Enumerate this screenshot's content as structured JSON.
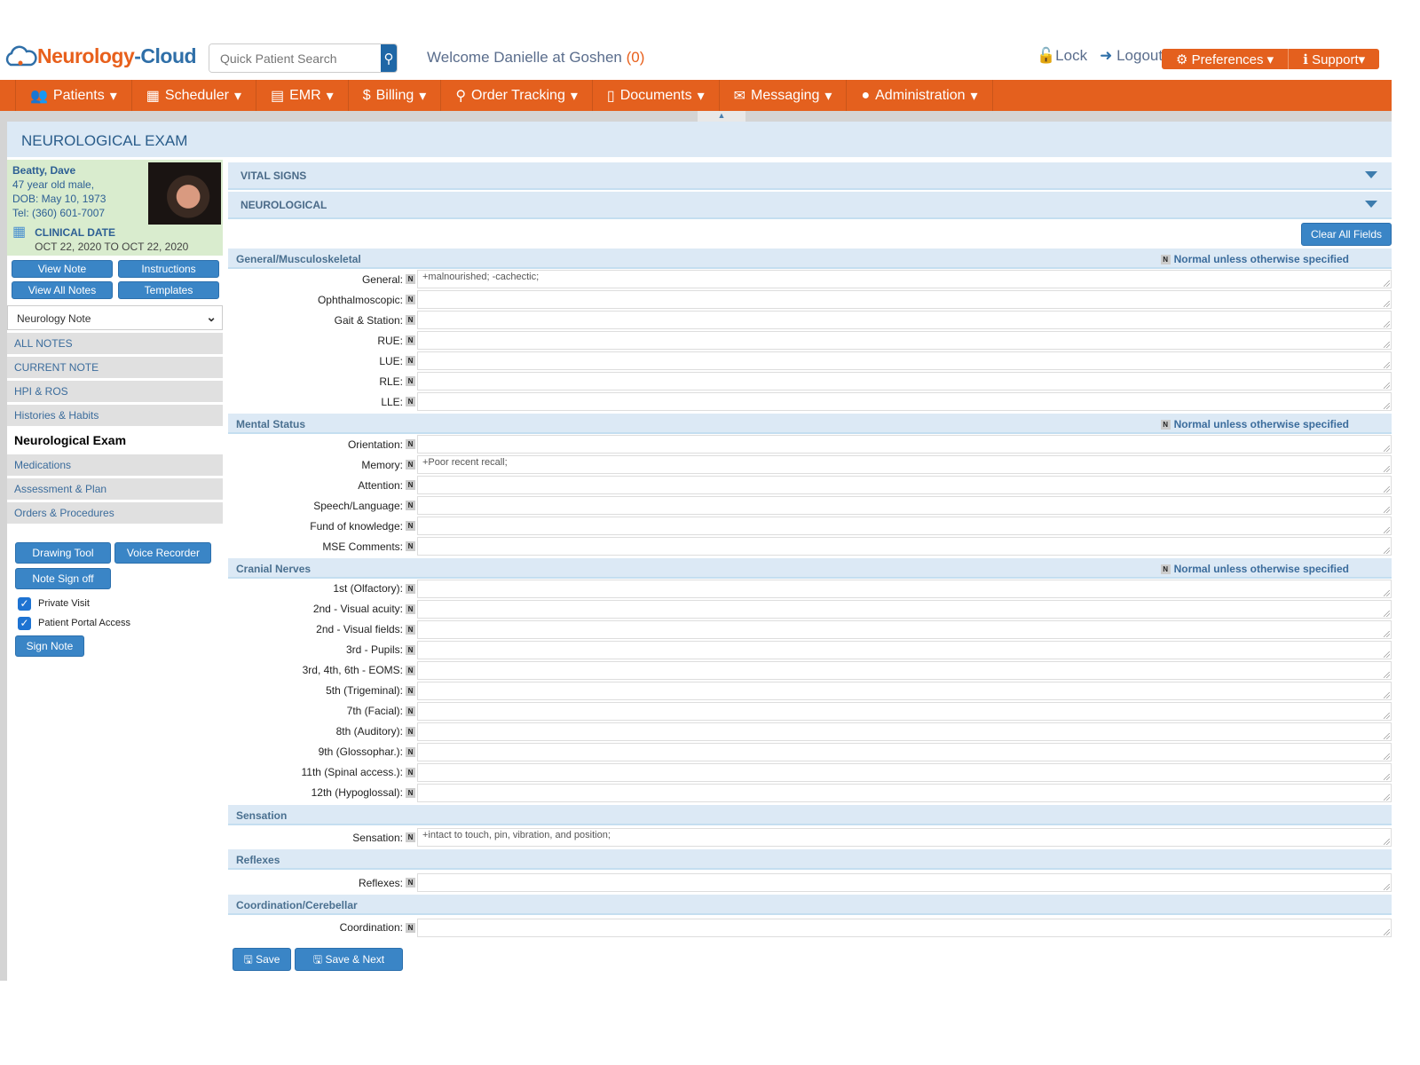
{
  "header": {
    "logo_a": "Neurology",
    "logo_sep": "-",
    "logo_b": "Cloud",
    "search_placeholder": "Quick Patient Search",
    "welcome": "Welcome Danielle at Goshen",
    "welcome_count": "(0)",
    "lock": "Lock",
    "logout": "Logout",
    "preferences": "Preferences",
    "support": "Support"
  },
  "nav": [
    {
      "label": "Patients",
      "icon": "users-icon",
      "glyph": "👥"
    },
    {
      "label": "Scheduler",
      "icon": "calendar-icon",
      "glyph": "▦"
    },
    {
      "label": "EMR",
      "icon": "files-icon",
      "glyph": "▤"
    },
    {
      "label": "Billing",
      "icon": "dollar-icon",
      "glyph": "$"
    },
    {
      "label": "Order Tracking",
      "icon": "search-icon",
      "glyph": "⚲"
    },
    {
      "label": "Documents",
      "icon": "document-icon",
      "glyph": "▯"
    },
    {
      "label": "Messaging",
      "icon": "envelope-icon",
      "glyph": "✉"
    },
    {
      "label": "Administration",
      "icon": "user-icon",
      "glyph": "●"
    }
  ],
  "page_title": "NEUROLOGICAL EXAM",
  "patient": {
    "name": "Beatty, Dave",
    "age_sex": "47 year old male,",
    "dob": "DOB: May 10, 1973",
    "tel": "Tel: (360) 601-7007",
    "clinical_date_label": "CLINICAL DATE",
    "clinical_date": "OCT 22, 2020 TO OCT 22, 2020"
  },
  "sidebar": {
    "buttons": [
      "View Note",
      "Instructions",
      "View All Notes",
      "Templates"
    ],
    "note_type": "Neurology Note",
    "items": [
      "ALL NOTES",
      "CURRENT NOTE",
      "HPI & ROS",
      "Histories & Habits",
      "Neurological Exam",
      "Medications",
      "Assessment & Plan",
      "Orders & Procedures"
    ],
    "active_index": 4,
    "drawing_tool": "Drawing Tool",
    "voice_recorder": "Voice Recorder",
    "note_sign_off": "Note Sign off",
    "private_visit": "Private Visit",
    "private_visit_checked": true,
    "portal_access": "Patient Portal Access",
    "portal_access_checked": true,
    "sign_note": "Sign Note"
  },
  "main": {
    "accordions": [
      "VITAL SIGNS",
      "NEUROLOGICAL"
    ],
    "clear_all": "Clear All Fields",
    "n_badge": "N",
    "normal_text": "Normal unless otherwise specified",
    "sections": [
      {
        "title": "General/Musculoskeletal",
        "normal": true,
        "fields": [
          {
            "label": "General:",
            "value": "+malnourished; -cachectic;"
          },
          {
            "label": "Ophthalmoscopic:",
            "value": ""
          },
          {
            "label": "Gait & Station:",
            "value": ""
          },
          {
            "label": "RUE:",
            "value": ""
          },
          {
            "label": "LUE:",
            "value": ""
          },
          {
            "label": "RLE:",
            "value": ""
          },
          {
            "label": "LLE:",
            "value": ""
          }
        ]
      },
      {
        "title": "Mental Status",
        "normal": true,
        "fields": [
          {
            "label": "Orientation:",
            "value": ""
          },
          {
            "label": "Memory:",
            "value": "+Poor recent recall;"
          },
          {
            "label": "Attention:",
            "value": ""
          },
          {
            "label": "Speech/Language:",
            "value": ""
          },
          {
            "label": "Fund of knowledge:",
            "value": ""
          },
          {
            "label": "MSE Comments:",
            "value": ""
          }
        ]
      },
      {
        "title": "Cranial Nerves",
        "normal": true,
        "fields": [
          {
            "label": "1st (Olfactory):",
            "value": ""
          },
          {
            "label": "2nd - Visual acuity:",
            "value": ""
          },
          {
            "label": "2nd - Visual fields:",
            "value": ""
          },
          {
            "label": "3rd - Pupils:",
            "value": ""
          },
          {
            "label": "3rd, 4th, 6th - EOMS:",
            "value": ""
          },
          {
            "label": "5th (Trigeminal):",
            "value": ""
          },
          {
            "label": "7th (Facial):",
            "value": ""
          },
          {
            "label": "8th (Auditory):",
            "value": ""
          },
          {
            "label": "9th (Glossophar.):",
            "value": ""
          },
          {
            "label": "11th (Spinal access.):",
            "value": ""
          },
          {
            "label": "12th (Hypoglossal):",
            "value": ""
          }
        ]
      },
      {
        "title": "Sensation",
        "normal": false,
        "fields": [
          {
            "label": "Sensation:",
            "value": "+intact to touch, pin, vibration, and position;"
          }
        ]
      },
      {
        "title": "Reflexes",
        "normal": false,
        "fields": [
          {
            "label": "Reflexes:",
            "value": ""
          }
        ]
      },
      {
        "title": "Coordination/Cerebellar",
        "normal": false,
        "fields": [
          {
            "label": "Coordination:",
            "value": ""
          }
        ]
      }
    ],
    "save": "Save",
    "save_next": "Save & Next"
  },
  "colors": {
    "brand_orange": "#e4601e",
    "brand_blue": "#2f6fa8",
    "button_blue": "#3a85c6",
    "section_bg": "#dce9f5"
  }
}
